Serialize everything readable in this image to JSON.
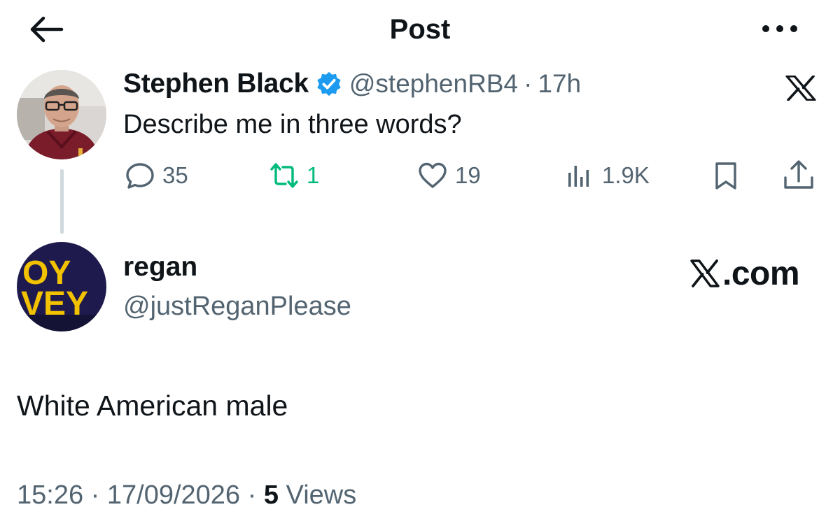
{
  "header": {
    "title": "Post",
    "back_icon": "arrow-left-icon",
    "more_icon": "more-horizontal-icon"
  },
  "original_post": {
    "author_name": "Stephen Black",
    "verified_icon": "verified-badge-icon",
    "handle": "@stephenRB4",
    "separator": "·",
    "time": "17h",
    "text": "Describe me in three words?",
    "platform_icon": "x-logo-icon",
    "actions": {
      "replies": "35",
      "reposts": "1",
      "likes": "19",
      "views": "1.9K"
    }
  },
  "reply": {
    "author_name": "regan",
    "handle": "@justReganPlease",
    "avatar_text": [
      "OY",
      "VEY"
    ],
    "text": "White American male",
    "watermark": ".com",
    "meta": {
      "time": "15:26",
      "separator": "·",
      "date": "17/09/2026",
      "views_count": "5",
      "views_label": "Views"
    }
  },
  "colors": {
    "text": "#0f1419",
    "secondary": "#536471",
    "verified": "#1d9bf0",
    "repost": "#00ba7c",
    "thread_line": "#cfd9de",
    "avatar2_bg": "#1e1a4d",
    "avatar2_text": "#f2c200"
  }
}
